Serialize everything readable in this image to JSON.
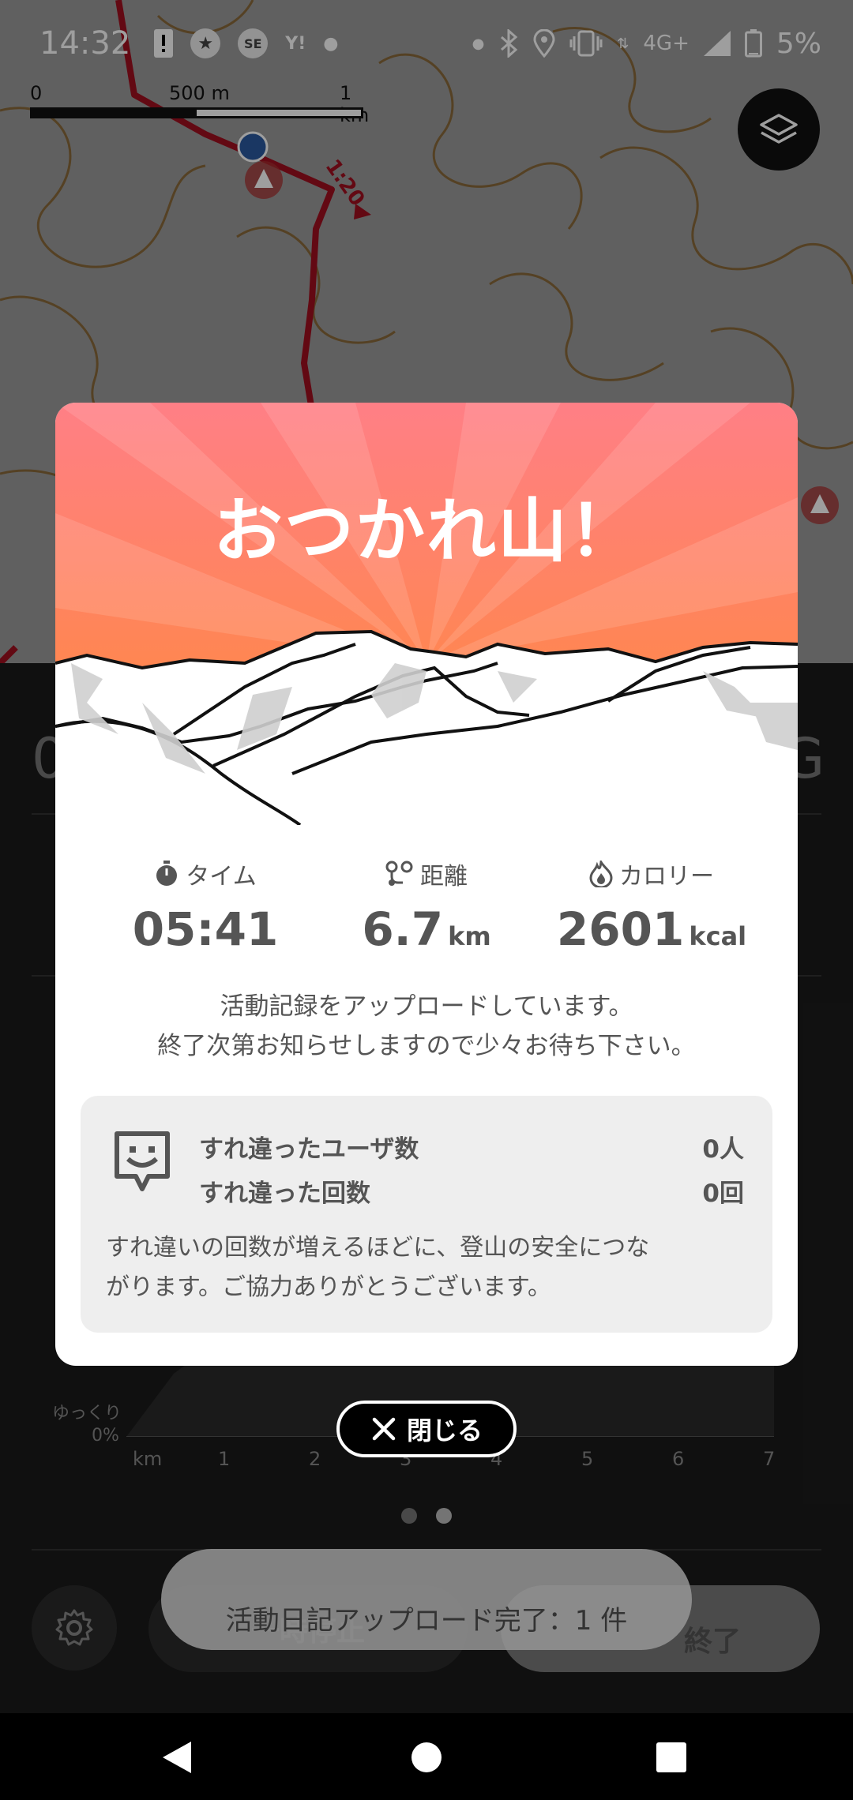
{
  "status_bar": {
    "time": "14:32",
    "network": "4G+",
    "battery": "5%"
  },
  "map": {
    "scale": {
      "zero": "0",
      "mid": "500 m",
      "max": "1 km"
    },
    "route_time_label": "1:20"
  },
  "modal": {
    "title": "おつかれ山！",
    "stats": {
      "time": {
        "label": "タイム",
        "value": "05:41",
        "unit": ""
      },
      "distance": {
        "label": "距離",
        "value": "6.7",
        "unit": "km"
      },
      "calories": {
        "label": "カロリー",
        "value": "2601",
        "unit": "kcal"
      }
    },
    "upload_message": {
      "line1": "活動記録をアップロードしています。",
      "line2": "終了次第お知らせしますので少々お待ち下さい。"
    },
    "passing": {
      "users_label": "すれ違ったユーザ数",
      "users_value": "0人",
      "count_label": "すれ違った回数",
      "count_value": "0回",
      "note_line1": "すれ違いの回数が増えるほどに、登山の安全につな",
      "note_line2": "がります。ご協力ありがとうございます。"
    }
  },
  "close_button": {
    "label": "閉じる"
  },
  "panel": {
    "left_digit": "0",
    "right_digit": "G",
    "pace_label": "ゆっくり",
    "pace_zero": "0%",
    "km_ticks": [
      "km",
      "1",
      "2",
      "3",
      "4",
      "5",
      "6",
      "7"
    ],
    "pause_label": "一時停止",
    "finish_label": "終了"
  },
  "toast": {
    "text": "活動日記アップロード完了：1 件"
  },
  "colors": {
    "hero_top": "#ff8080",
    "hero_bottom": "#ff8a3c",
    "route": "#a01020"
  }
}
